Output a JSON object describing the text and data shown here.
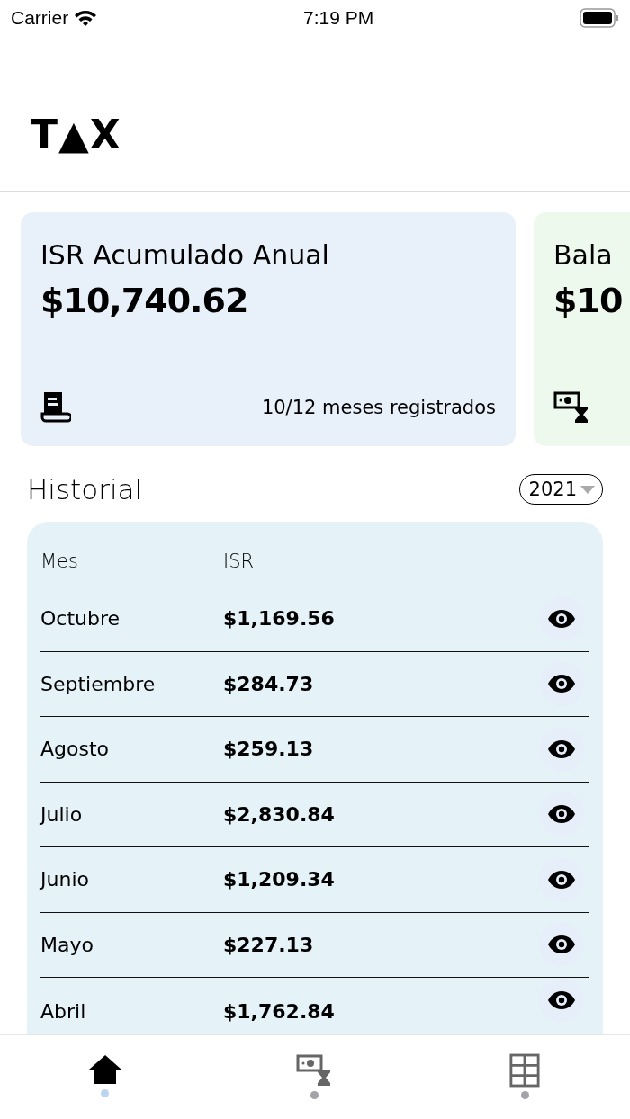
{
  "status_bar": {
    "carrier": "Carrier",
    "time": "7:19 PM"
  },
  "header": {
    "logo": "T▲X"
  },
  "cards": [
    {
      "title": "ISR Acumulado Anual",
      "amount": "$10,740.62",
      "footnote": "10/12 meses registrados",
      "kind": "receipt",
      "color": "#e8f0fa"
    },
    {
      "title": "Bala",
      "amount": "$10",
      "kind": "cash-timer",
      "color": "#eef9ee"
    }
  ],
  "history": {
    "title": "Historial",
    "year": "2021",
    "columns": [
      "Mes",
      "ISR"
    ],
    "rows": [
      {
        "month": "Octubre",
        "isr": "$1,169.56"
      },
      {
        "month": "Septiembre",
        "isr": "$284.73"
      },
      {
        "month": "Agosto",
        "isr": "$259.13"
      },
      {
        "month": "Julio",
        "isr": "$2,830.84"
      },
      {
        "month": "Junio",
        "isr": "$1,209.34"
      },
      {
        "month": "Mayo",
        "isr": "$227.13"
      },
      {
        "month": "Abril",
        "isr": "$1,762.84"
      }
    ]
  },
  "tab_bar": [
    {
      "kind": "home",
      "selected": true
    },
    {
      "kind": "cash-timer",
      "selected": false
    },
    {
      "kind": "grid",
      "selected": false
    }
  ]
}
